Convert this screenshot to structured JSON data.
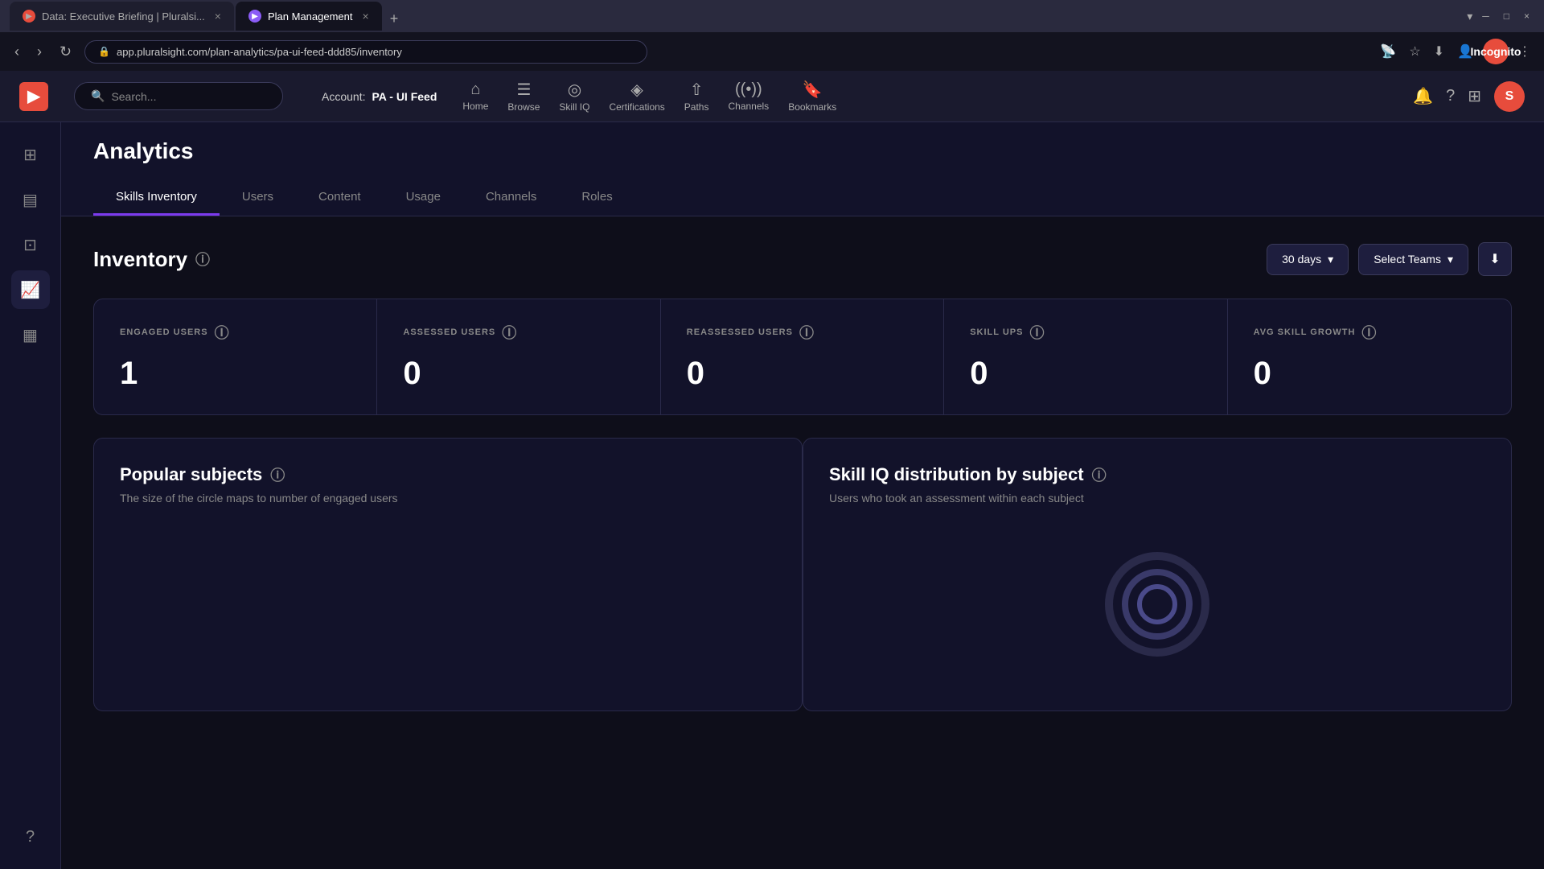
{
  "browser": {
    "tabs": [
      {
        "id": "tab1",
        "favicon_type": "red",
        "label": "Data: Executive Briefing | Pluralsi...",
        "active": false
      },
      {
        "id": "tab2",
        "favicon_type": "purple",
        "label": "Plan Management",
        "active": true
      }
    ],
    "new_tab_label": "+",
    "address": "app.pluralsight.com/plan-analytics/pa-ui-feed-ddd85/inventory",
    "account_label": "Incognito",
    "window_controls": {
      "minimize": "−",
      "maximize": "□",
      "close": "×"
    }
  },
  "header": {
    "logo": "▶",
    "nav": [
      {
        "id": "home",
        "icon": "⌂",
        "label": "Home"
      },
      {
        "id": "browse",
        "icon": "☰",
        "label": "Browse"
      }
    ],
    "search_placeholder": "Search...",
    "account_prefix": "Account:",
    "account_name": "PA - UI Feed",
    "skill_iq": {
      "icon": "◎",
      "label": "Skill IQ"
    },
    "certifications": {
      "icon": "◈",
      "label": "Certifications"
    },
    "paths": {
      "icon": "⇧",
      "label": "Paths"
    },
    "channels": {
      "icon": "((•))",
      "label": "Channels"
    },
    "bookmarks": {
      "icon": "🔖",
      "label": "Bookmarks"
    },
    "avatar_letter": "S"
  },
  "sidebar": {
    "items": [
      {
        "id": "overview",
        "icon": "⊞"
      },
      {
        "id": "reports",
        "icon": "▤"
      },
      {
        "id": "hierarchy",
        "icon": "⊡"
      },
      {
        "id": "analytics",
        "icon": "📈",
        "active": true
      },
      {
        "id": "content",
        "icon": "▦"
      }
    ],
    "help_icon": "?"
  },
  "analytics": {
    "title": "Analytics",
    "tabs": [
      {
        "id": "skills-inventory",
        "label": "Skills Inventory",
        "active": true
      },
      {
        "id": "users",
        "label": "Users",
        "active": false
      },
      {
        "id": "content",
        "label": "Content",
        "active": false
      },
      {
        "id": "usage",
        "label": "Usage",
        "active": false
      },
      {
        "id": "channels",
        "label": "Channels",
        "active": false
      },
      {
        "id": "roles",
        "label": "Roles",
        "active": false
      }
    ]
  },
  "inventory": {
    "title": "Inventory",
    "period_label": "30 days",
    "select_teams_label": "Select Teams",
    "download_icon": "⬇",
    "chevron_down": "▾",
    "stats": [
      {
        "id": "engaged-users",
        "label": "ENGAGED USERS",
        "value": "1"
      },
      {
        "id": "assessed-users",
        "label": "ASSESSED USERS",
        "value": "0"
      },
      {
        "id": "reassessed-users",
        "label": "REASSESSED USERS",
        "value": "0"
      },
      {
        "id": "skill-ups",
        "label": "SKILL UPS",
        "value": "0"
      },
      {
        "id": "avg-skill-growth",
        "label": "AVG SKILL GROWTH",
        "value": "0"
      }
    ]
  },
  "popular_subjects": {
    "title": "Popular subjects",
    "subtitle": "The size of the circle maps to number of engaged users",
    "info_icon": "ⓘ"
  },
  "skill_iq_distribution": {
    "title": "Skill IQ distribution by subject",
    "subtitle": "Users who took an assessment within each subject",
    "info_icon": "ⓘ"
  }
}
